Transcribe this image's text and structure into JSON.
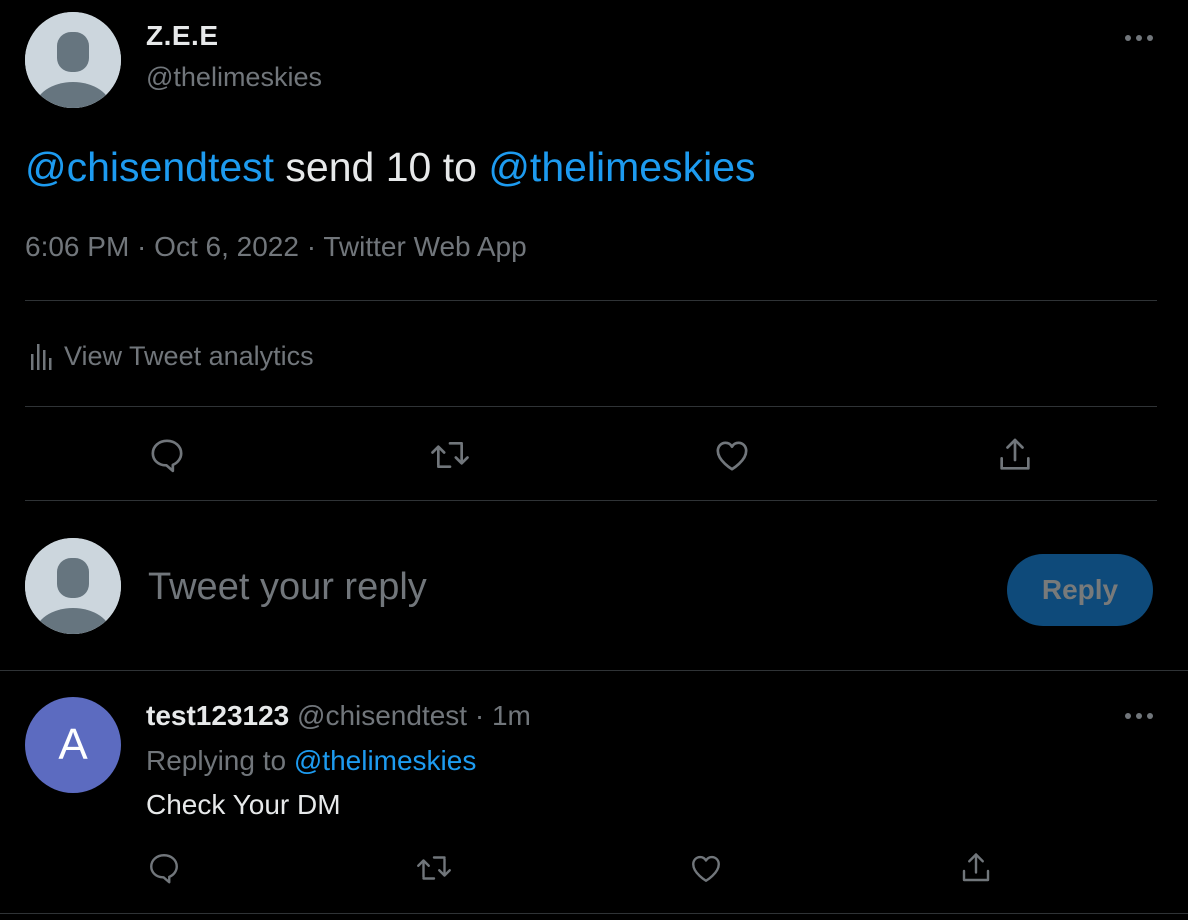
{
  "tweet": {
    "author_name": "Z.E.E",
    "author_handle": "@thelimeskies",
    "text_mention_1": "@chisendtest",
    "text_middle": " send 10 to ",
    "text_mention_2": "@thelimeskies",
    "time": "6:06 PM",
    "separator": " · ",
    "date": "Oct 6, 2022",
    "source": "Twitter Web App",
    "analytics_label": "View Tweet analytics"
  },
  "actions": {
    "reply_icon": "reply-icon",
    "retweet_icon": "retweet-icon",
    "like_icon": "heart-icon",
    "share_icon": "share-icon"
  },
  "composer": {
    "placeholder": "Tweet your reply",
    "button_label": "Reply"
  },
  "reply": {
    "avatar_letter": "A",
    "avatar_color": "#5c6bc0",
    "name": "test123123",
    "handle": "@chisendtest",
    "dot": " · ",
    "time": "1m",
    "replying_prefix": "Replying to ",
    "replying_handle": "@thelimeskies",
    "body": "Check Your DM"
  },
  "colors": {
    "background": "#000000",
    "text": "#e7e9ea",
    "secondary": "#71767b",
    "accent": "#1d9bf0",
    "divider": "#2f3336",
    "reply_button_bg": "#0e4a7a"
  }
}
